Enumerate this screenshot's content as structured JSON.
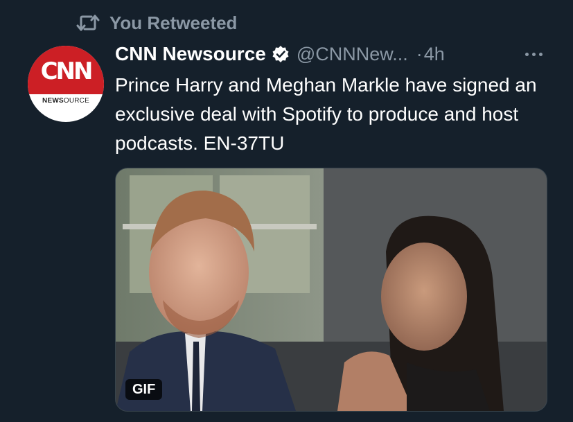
{
  "retweet": {
    "icon": "retweet-icon",
    "label": "You Retweeted"
  },
  "avatar": {
    "logo_text": "CNN",
    "sub_bold": "NEWS",
    "sub_rest": "OURCE"
  },
  "tweet": {
    "name": "CNN Newsource",
    "verified_icon": "verified-badge-icon",
    "handle": "@CNNNew...",
    "dot": "·",
    "time": "4h",
    "more_icon": "more-options-icon",
    "text": "Prince Harry and Meghan Markle have signed an exclusive deal with Spotify to produce and host podcasts. EN-37TU"
  },
  "media": {
    "badge": "GIF"
  },
  "colors": {
    "background": "#15202b",
    "secondary_text": "#8b98a5",
    "primary_text": "#ffffff",
    "cnn_red": "#cc1f25"
  }
}
